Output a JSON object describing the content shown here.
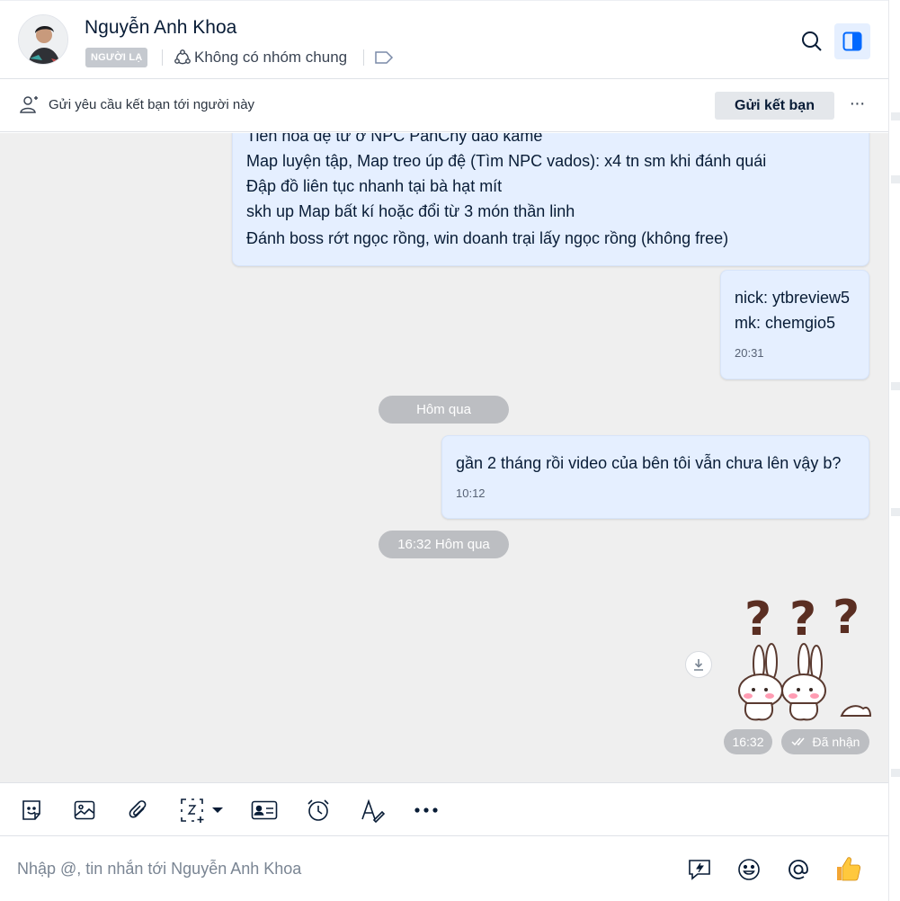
{
  "header": {
    "name": "Nguyễn Anh Khoa",
    "badge": "NGƯỜI LẠ",
    "group_info": "Không có nhóm chung"
  },
  "friend_bar": {
    "request_text": "Gửi yêu cầu kết bạn tới người này",
    "send_button": "Gửi kết bạn",
    "more": "···"
  },
  "messages": {
    "msg1": {
      "lines": [
        "Tiến hóa đệ tử ở NPC PanChy đảo kame",
        "Map luyện tập, Map treo úp đệ (Tìm NPC vados): x4 tn sm khi đánh quái",
        "Đập đồ liên tục nhanh tại bà hạt mít",
        "skh up Map bất kí hoặc đổi từ 3 món thần linh",
        "Đánh boss rớt ngọc rồng, win doanh trại lấy ngọc rồng (không free)"
      ]
    },
    "msg2": {
      "lines": [
        "nick: ytbreview5",
        "mk: chemgio5"
      ],
      "time": "20:31"
    },
    "divider1": "Hôm qua",
    "msg3": {
      "text": "gần 2 tháng rồi video của bên tôi vẫn chưa lên vậy b?",
      "time": "10:12"
    },
    "divider2": "16:32 Hôm qua",
    "sticker": {
      "time": "16:32",
      "status": "Đã nhận"
    }
  },
  "composer": {
    "placeholder": "Nhập @, tin nhắn tới Nguyễn Anh Khoa"
  },
  "colors": {
    "bubble": "#e5efff",
    "chat_bg": "#efefef",
    "accent": "#0068ff"
  }
}
